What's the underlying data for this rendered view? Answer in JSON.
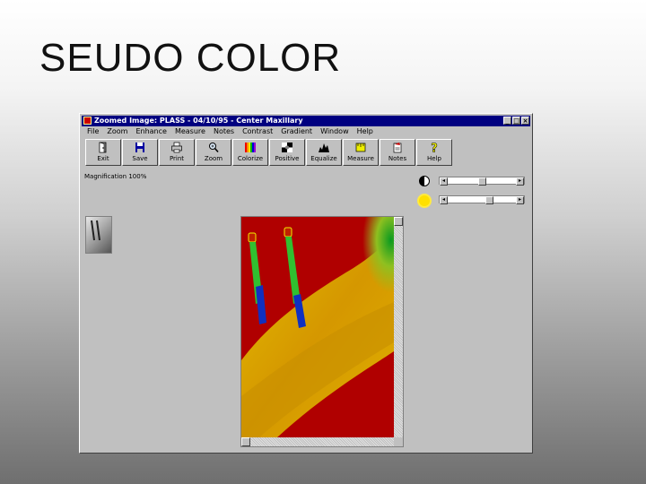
{
  "slide": {
    "title": "SEUDO COLOR"
  },
  "window": {
    "title": "Zoomed Image: PLASS - 04/10/95 - Center Maxillary",
    "controls": [
      "_",
      "□",
      "×"
    ]
  },
  "menu": [
    "File",
    "Zoom",
    "Enhance",
    "Measure",
    "Notes",
    "Contrast",
    "Gradient",
    "Window",
    "Help"
  ],
  "toolbar": [
    {
      "label": "Exit",
      "icon": "exit-door-icon"
    },
    {
      "label": "Save",
      "icon": "floppy-disk-icon"
    },
    {
      "label": "Print",
      "icon": "printer-icon"
    },
    {
      "label": "Zoom",
      "icon": "magnifier-icon"
    },
    {
      "label": "Colorize",
      "icon": "rainbow-bars-icon"
    },
    {
      "label": "Positive",
      "icon": "positive-negative-icon"
    },
    {
      "label": "Equalize",
      "icon": "histogram-icon"
    },
    {
      "label": "Measure",
      "icon": "ruler-icon"
    },
    {
      "label": "Notes",
      "icon": "notes-icon"
    },
    {
      "label": "Help",
      "icon": "question-mark-icon"
    }
  ],
  "status": {
    "magnification": "Magnification 100%"
  },
  "sliders": [
    {
      "name": "contrast",
      "icon": "contrast-icon",
      "level": 0.5
    },
    {
      "name": "brightness",
      "icon": "sun-brightness-icon",
      "level": 0.55
    }
  ],
  "colors": {
    "titlebar": "#000080",
    "pseudo_red": "#b80000",
    "pseudo_yellow": "#e8d200",
    "pseudo_green": "#1aa81a",
    "pseudo_blue": "#1030c0"
  }
}
